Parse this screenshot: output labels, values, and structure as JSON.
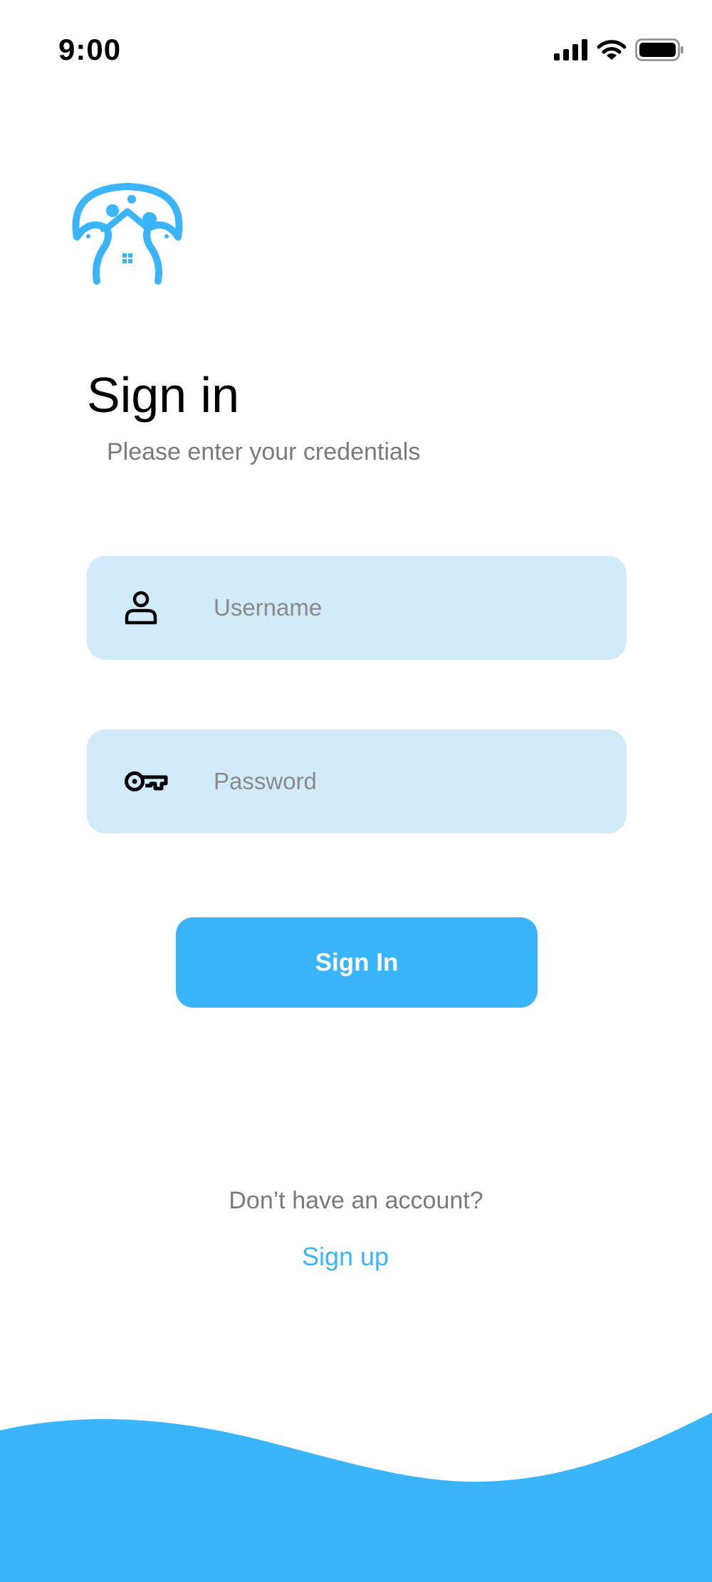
{
  "status_bar": {
    "time": "9:00",
    "icons": [
      "cellular-signal-icon",
      "wifi-icon",
      "battery-icon"
    ]
  },
  "logo": {
    "icon": "mushroom-house-logo"
  },
  "header": {
    "title": "Sign in",
    "subtitle": "Please enter your credentials"
  },
  "form": {
    "username": {
      "placeholder": "Username",
      "value": "",
      "icon": "user-icon"
    },
    "password": {
      "placeholder": "Password",
      "value": "",
      "icon": "key-icon"
    },
    "submit_label": "Sign In"
  },
  "footer": {
    "prompt": "Don’t have an account?",
    "signup_label": "Sign up"
  },
  "colors": {
    "accent": "#3ab4fa",
    "field_background": "#d2ebfb",
    "muted_text": "#7a7a7a"
  }
}
